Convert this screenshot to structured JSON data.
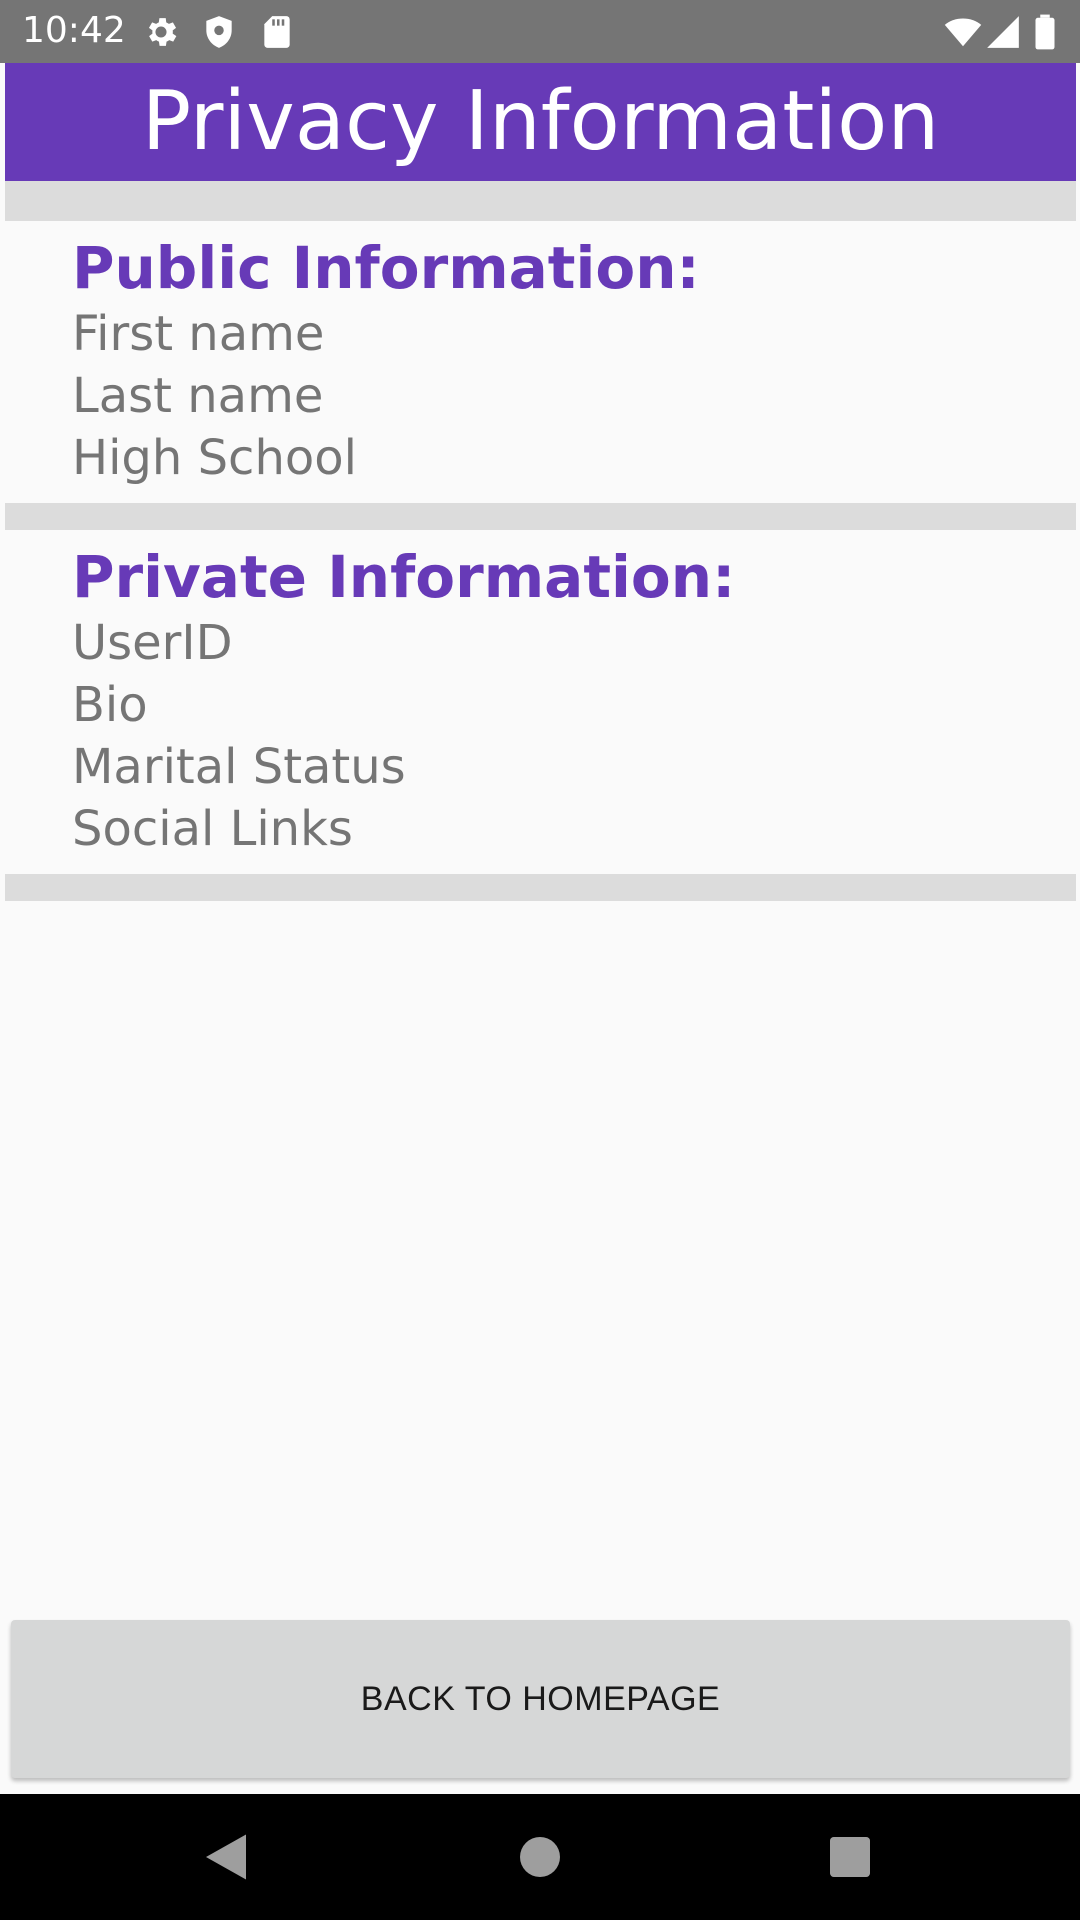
{
  "status_bar": {
    "time": "10:42",
    "left_icons": [
      "gear-icon",
      "shield-icon",
      "sd-card-icon"
    ],
    "right_icons": [
      "wifi-icon",
      "signal-icon",
      "battery-icon"
    ]
  },
  "header": {
    "title": "Privacy Information",
    "background_color": "#673ab7"
  },
  "sections": [
    {
      "heading": "Public Information:",
      "items": [
        "First name",
        "Last name",
        "High School"
      ]
    },
    {
      "heading": "Private Information:",
      "items": [
        "UserID",
        "Bio",
        "Marital Status",
        "Social Links"
      ]
    }
  ],
  "colors": {
    "accent": "#673ab7",
    "item_text": "#757575",
    "band": "#dcdcdc",
    "button": "#d6d7d7"
  },
  "footer": {
    "back_button_label": "BACK TO HOMEPAGE"
  },
  "nav_bar": {
    "icons": [
      "back-triangle-icon",
      "home-circle-icon",
      "recents-square-icon"
    ]
  }
}
